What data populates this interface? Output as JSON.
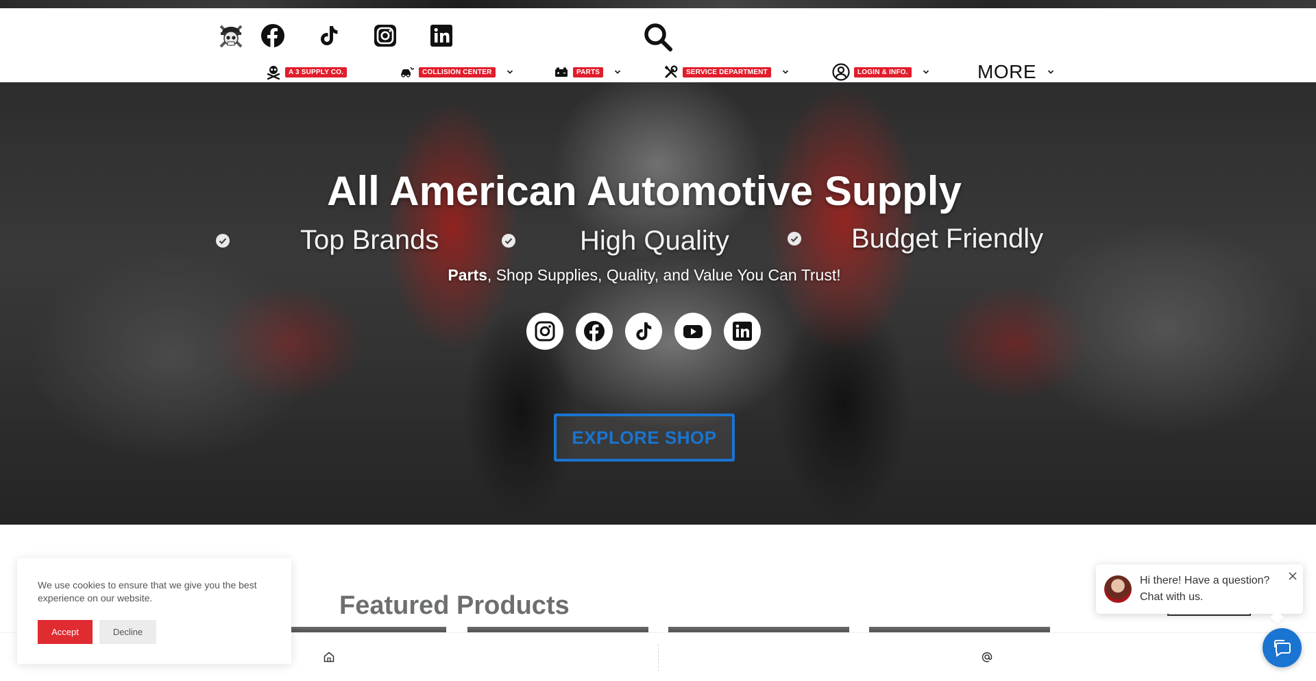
{
  "header": {
    "social_icons": [
      "facebook-icon",
      "tiktok-icon",
      "instagram-icon",
      "linkedin-icon"
    ],
    "nav": [
      {
        "label": "A 3 SUPPLY CO.",
        "icon": "skull-crossbones-icon",
        "has_dropdown": false
      },
      {
        "label": "COLLISION CENTER",
        "icon": "car-crash-icon",
        "has_dropdown": true
      },
      {
        "label": "PARTS",
        "icon": "car-battery-icon",
        "has_dropdown": true
      },
      {
        "label": "SERVICE DEPARTMENT",
        "icon": "tools-icon",
        "has_dropdown": true
      },
      {
        "label": "LOGIN & INFO.",
        "icon": "user-circle-icon",
        "has_dropdown": true
      },
      {
        "label": "MORE",
        "icon": "",
        "has_dropdown": true
      }
    ]
  },
  "hero": {
    "title": "All American Automotive Supply",
    "features": [
      "Top Brands",
      "High Quality",
      "Budget Friendly"
    ],
    "tagline_bold": "Parts",
    "tagline_rest": ", Shop Supplies, Quality, and Value You Can Trust!",
    "social_icons": [
      "instagram-icon",
      "facebook-icon",
      "tiktok-icon",
      "youtube-icon",
      "linkedin-icon"
    ],
    "cta_label": "EXPLORE SHOP"
  },
  "featured": {
    "title": "Featured Products"
  },
  "cookie": {
    "text": "We use cookies to ensure that we give you the best experience on our website.",
    "accept_label": "Accept",
    "decline_label": "Decline"
  },
  "chat": {
    "message": "Hi there! Have a question? Chat with us."
  },
  "colors": {
    "accent_red": "#e11d2c",
    "accent_blue": "#1a74d2"
  }
}
